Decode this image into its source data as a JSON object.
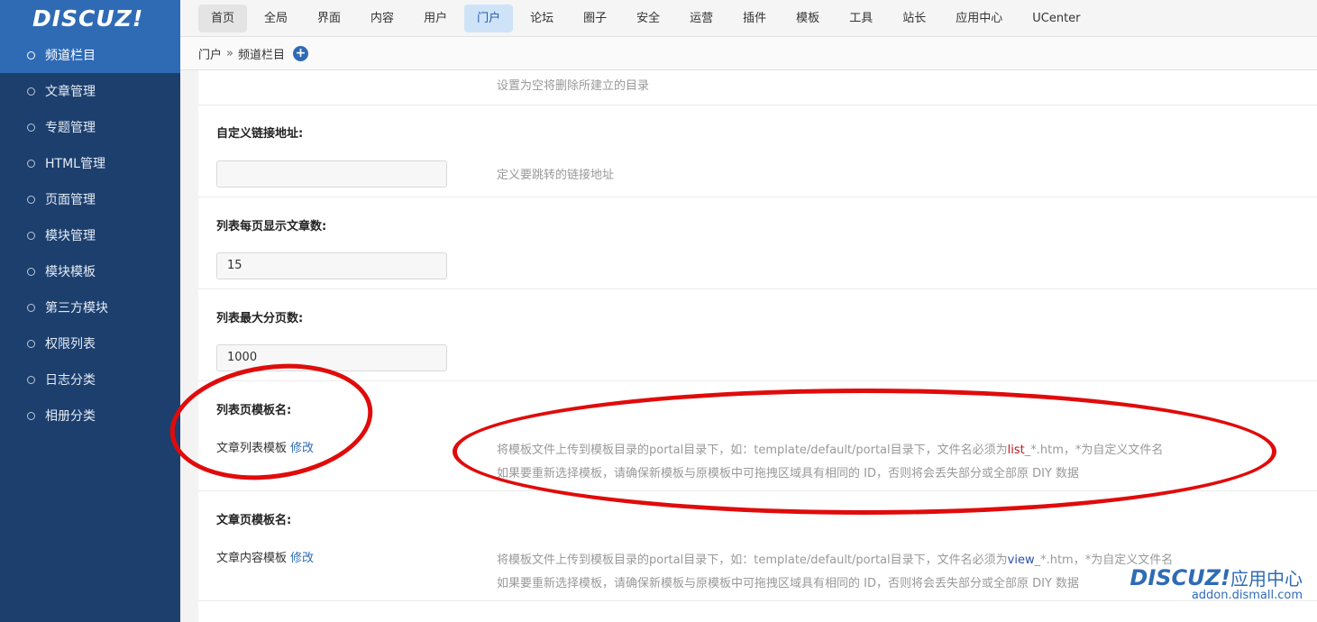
{
  "logo": "DISCUZ!",
  "topnav": [
    "首页",
    "全局",
    "界面",
    "内容",
    "用户",
    "门户",
    "论坛",
    "圈子",
    "安全",
    "运营",
    "插件",
    "模板",
    "工具",
    "站长",
    "应用中心",
    "UCenter"
  ],
  "sidebar": [
    "频道栏目",
    "文章管理",
    "专题管理",
    "HTML管理",
    "页面管理",
    "模块管理",
    "模块模板",
    "第三方模块",
    "权限列表",
    "日志分类",
    "相册分类"
  ],
  "breadcrumb": {
    "root": "门户",
    "sep": "»",
    "current": "频道栏目",
    "add": "+"
  },
  "form": {
    "top_hint": "设置为空将删除所建立的目录",
    "custom_link": {
      "label": "自定义链接地址:",
      "value": "",
      "hint": "定义要跳转的链接地址"
    },
    "per_page": {
      "label": "列表每页显示文章数:",
      "value": "15"
    },
    "max_pages": {
      "label": "列表最大分页数:",
      "value": "1000"
    },
    "list_tpl": {
      "label": "列表页模板名:",
      "value": "文章列表模板",
      "edit": "修改",
      "hint1_pre": "将模板文件上传到模板目录的portal目录下，如：template/default/portal目录下，文件名必须为",
      "hint1_key": "list",
      "hint1_post": "_*.htm，*为自定义文件名",
      "hint2": "如果要重新选择模板，请确保新模板与原模板中可拖拽区域具有相同的 ID，否则将会丢失部分或全部原 DIY 数据"
    },
    "view_tpl": {
      "label": "文章页模板名:",
      "value": "文章内容模板",
      "edit": "修改",
      "hint1_pre": "将模板文件上传到模板目录的portal目录下，如：template/default/portal目录下，文件名必须为",
      "hint1_key": "view",
      "hint1_post": "_*.htm，*为自定义文件名",
      "hint2": "如果要重新选择模板，请确保新模板与原模板中可拖拽区域具有相同的 ID，否则将会丢失部分或全部原 DIY 数据"
    }
  },
  "watermark": {
    "brand": "DISCUZ!",
    "brand_cn": "应用中心",
    "url": "addon.dismall.com"
  },
  "colors": {
    "sidebar": "#1c3f6e",
    "accent": "#2f6bb5",
    "annotation": "#e00b0b"
  }
}
